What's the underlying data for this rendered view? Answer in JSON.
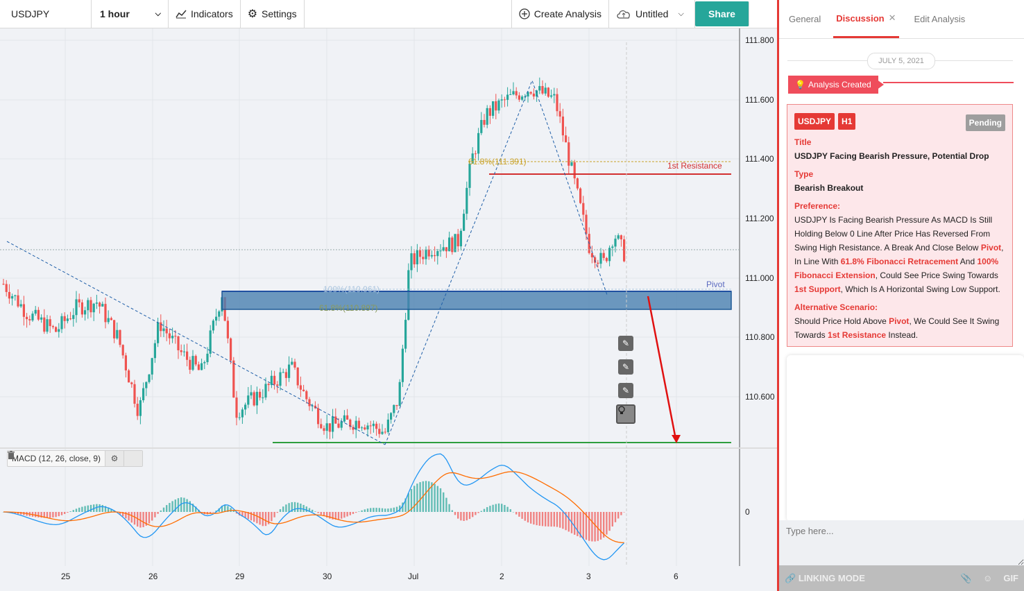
{
  "toolbar": {
    "symbol": "USDJPY",
    "interval": "1 hour",
    "indicators_label": "Indicators",
    "settings_label": "Settings",
    "create_analysis_label": "Create Analysis",
    "layout_name": "Untitled",
    "share_label": "Share"
  },
  "chart": {
    "price_axis": [
      "111.800",
      "111.600",
      "111.400",
      "111.200",
      "111.000",
      "110.800",
      "110.600"
    ],
    "time_axis": [
      "25",
      "26",
      "29",
      "30",
      "Jul",
      "2",
      "3",
      "6"
    ],
    "macd_zero": "0",
    "annotations": {
      "fib_618_top": "61.8%(111.391)",
      "resistance": "1st Resistance",
      "fib_100": "100%(110.961)",
      "fib_618_bottom": "61.8%(110.897)",
      "pivot": "Pivot"
    },
    "macd_legend": "MACD (12, 26, close, 9)",
    "colors": {
      "up": "#26a69a",
      "down": "#ef5350",
      "macd": "#2196f3",
      "signal": "#ff6d00",
      "zone": "#4a7fb0"
    }
  },
  "panel": {
    "tabs": [
      "General",
      "Discussion",
      "Edit Analysis"
    ],
    "active_tab": "Discussion",
    "date": "JULY 5, 2021",
    "created_label": "Analysis Created",
    "badges": [
      "USDJPY",
      "H1"
    ],
    "status": "Pending",
    "title_label": "Title",
    "title_value": "USDJPY Facing Bearish Pressure, Potential Drop",
    "type_label": "Type",
    "type_value": "Bearish Breakout",
    "preference_label": "Preference:",
    "pref_1": "USDJPY Is Facing Bearish Pressure As MACD Is Still Holding Below 0 Line After Price Has Reversed From Swing High Resistance. A Break And Close Below ",
    "pref_hl_1": "Pivot",
    "pref_2": ", In Line With ",
    "pref_hl_2": "61.8% Fibonacci Retracement",
    "pref_3": " And ",
    "pref_hl_3": "100% Fibonacci Extension",
    "pref_4": ", Could See Price Swing Towards ",
    "pref_hl_4": "1st Support",
    "pref_5": ", Which Is A Horizontal Swing Low Support.",
    "alt_label": "Alternative Scenario:",
    "alt_1": "Should Price Hold Above ",
    "alt_hl_1": "Pivot",
    "alt_2": ", We Could See It Swing Towards ",
    "alt_hl_2": "1st Resistance",
    "alt_3": " Instead.",
    "input_placeholder": "Type here...",
    "linking_mode": "LINKING MODE",
    "gif_label": "GIF"
  }
}
